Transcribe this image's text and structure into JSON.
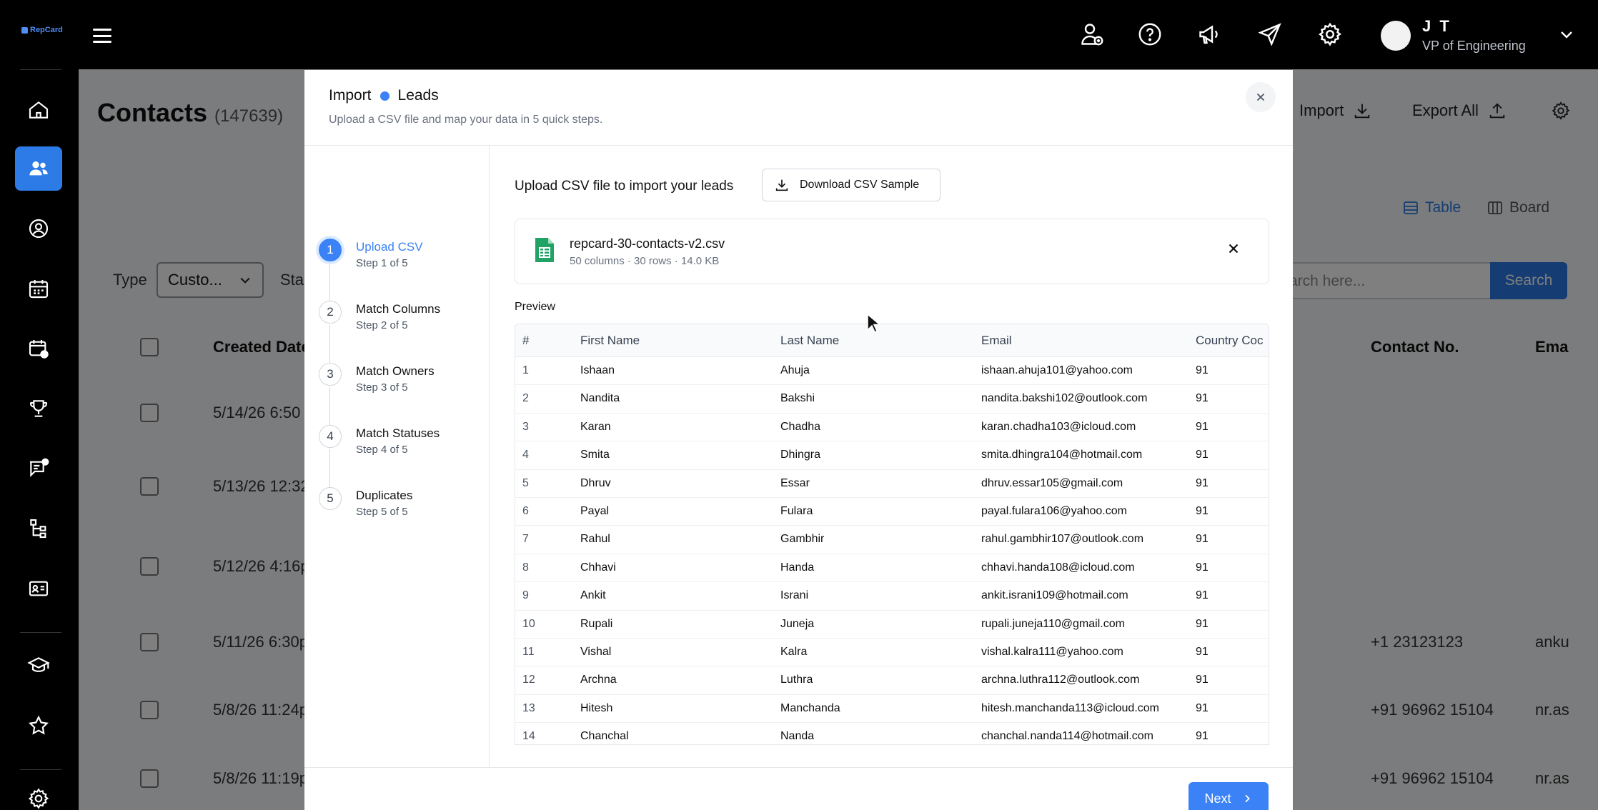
{
  "app": {
    "logo_text": "RepCard",
    "user": {
      "initials": "J T",
      "role": "VP of Engineering"
    },
    "top_icons": [
      "add-user-icon",
      "help-icon",
      "megaphone-icon",
      "send-icon",
      "gear-icon"
    ],
    "sidebar_icons": [
      "home-icon",
      "contacts-icon",
      "user-search-icon",
      "calendar-icon",
      "calendar-settings-icon",
      "trophy-icon",
      "chat-icon",
      "org-chart-icon",
      "id-card-icon",
      "graduation-cap-icon",
      "star-icon",
      "gear-icon"
    ]
  },
  "background_page": {
    "title": "Contacts",
    "count": "(147639)",
    "import_label": "Import",
    "export_label": "Export All",
    "view_table": "Table",
    "view_board": "Board",
    "type_label": "Type",
    "type_value": "Custo...",
    "status_label": "Sta",
    "search_placeholder": "arch here...",
    "search_button": "Search",
    "columns": [
      "Created Date",
      "Contact No.",
      "Ema"
    ],
    "rows": [
      {
        "date": "5/14/26 6:50",
        "phone": "",
        "email": ""
      },
      {
        "date": "5/13/26 12:32",
        "phone": "",
        "email": ""
      },
      {
        "date": "5/12/26 4:16p",
        "phone": "",
        "email": ""
      },
      {
        "date": "5/11/26 6:30p",
        "phone": "+1 23123123",
        "email": "anku"
      },
      {
        "date": "5/8/26 11:24p",
        "phone": "+91 96962 15104",
        "email": "nr.as"
      },
      {
        "date": "5/8/26 11:19p",
        "phone": "+91 96962 15104",
        "email": "nr.as"
      }
    ]
  },
  "modal": {
    "title_prefix": "Import",
    "title_entity": "Leads",
    "subtitle": "Upload a CSV file and map your data in 5 quick steps.",
    "steps": [
      {
        "num": "1",
        "label": "Upload CSV",
        "sub": "Step 1 of 5",
        "active": true
      },
      {
        "num": "2",
        "label": "Match Columns",
        "sub": "Step 2 of 5",
        "active": false
      },
      {
        "num": "3",
        "label": "Match Owners",
        "sub": "Step 3 of 5",
        "active": false
      },
      {
        "num": "4",
        "label": "Match Statuses",
        "sub": "Step 4 of 5",
        "active": false
      },
      {
        "num": "5",
        "label": "Duplicates",
        "sub": "Step 5 of 5",
        "active": false
      }
    ],
    "content_title": "Upload CSV file to import your leads",
    "download_label": "Download CSV Sample",
    "file": {
      "name": "repcard-30-contacts-v2.csv",
      "meta": "50 columns · 30 rows · 14.0 KB"
    },
    "preview_label": "Preview",
    "table": {
      "columns": [
        "#",
        "First Name",
        "Last Name",
        "Email",
        "Country Coc"
      ],
      "rows": [
        [
          "1",
          "Ishaan",
          "Ahuja",
          "ishaan.ahuja101@yahoo.com",
          "91"
        ],
        [
          "2",
          "Nandita",
          "Bakshi",
          "nandita.bakshi102@outlook.com",
          "91"
        ],
        [
          "3",
          "Karan",
          "Chadha",
          "karan.chadha103@icloud.com",
          "91"
        ],
        [
          "4",
          "Smita",
          "Dhingra",
          "smita.dhingra104@hotmail.com",
          "91"
        ],
        [
          "5",
          "Dhruv",
          "Essar",
          "dhruv.essar105@gmail.com",
          "91"
        ],
        [
          "6",
          "Payal",
          "Fulara",
          "payal.fulara106@yahoo.com",
          "91"
        ],
        [
          "7",
          "Rahul",
          "Gambhir",
          "rahul.gambhir107@outlook.com",
          "91"
        ],
        [
          "8",
          "Chhavi",
          "Handa",
          "chhavi.handa108@icloud.com",
          "91"
        ],
        [
          "9",
          "Ankit",
          "Israni",
          "ankit.israni109@hotmail.com",
          "91"
        ],
        [
          "10",
          "Rupali",
          "Juneja",
          "rupali.juneja110@gmail.com",
          "91"
        ],
        [
          "11",
          "Vishal",
          "Kalra",
          "vishal.kalra111@yahoo.com",
          "91"
        ],
        [
          "12",
          "Archna",
          "Luthra",
          "archna.luthra112@outlook.com",
          "91"
        ],
        [
          "13",
          "Hitesh",
          "Manchanda",
          "hitesh.manchanda113@icloud.com",
          "91"
        ],
        [
          "14",
          "Chanchal",
          "Nanda",
          "chanchal.nanda114@hotmail.com",
          "91"
        ]
      ]
    },
    "next_label": "Next"
  },
  "colors": {
    "accent": "#3b82f6",
    "sidebar_active": "#2d7be6",
    "spreadsheet_green": "#21a366"
  }
}
